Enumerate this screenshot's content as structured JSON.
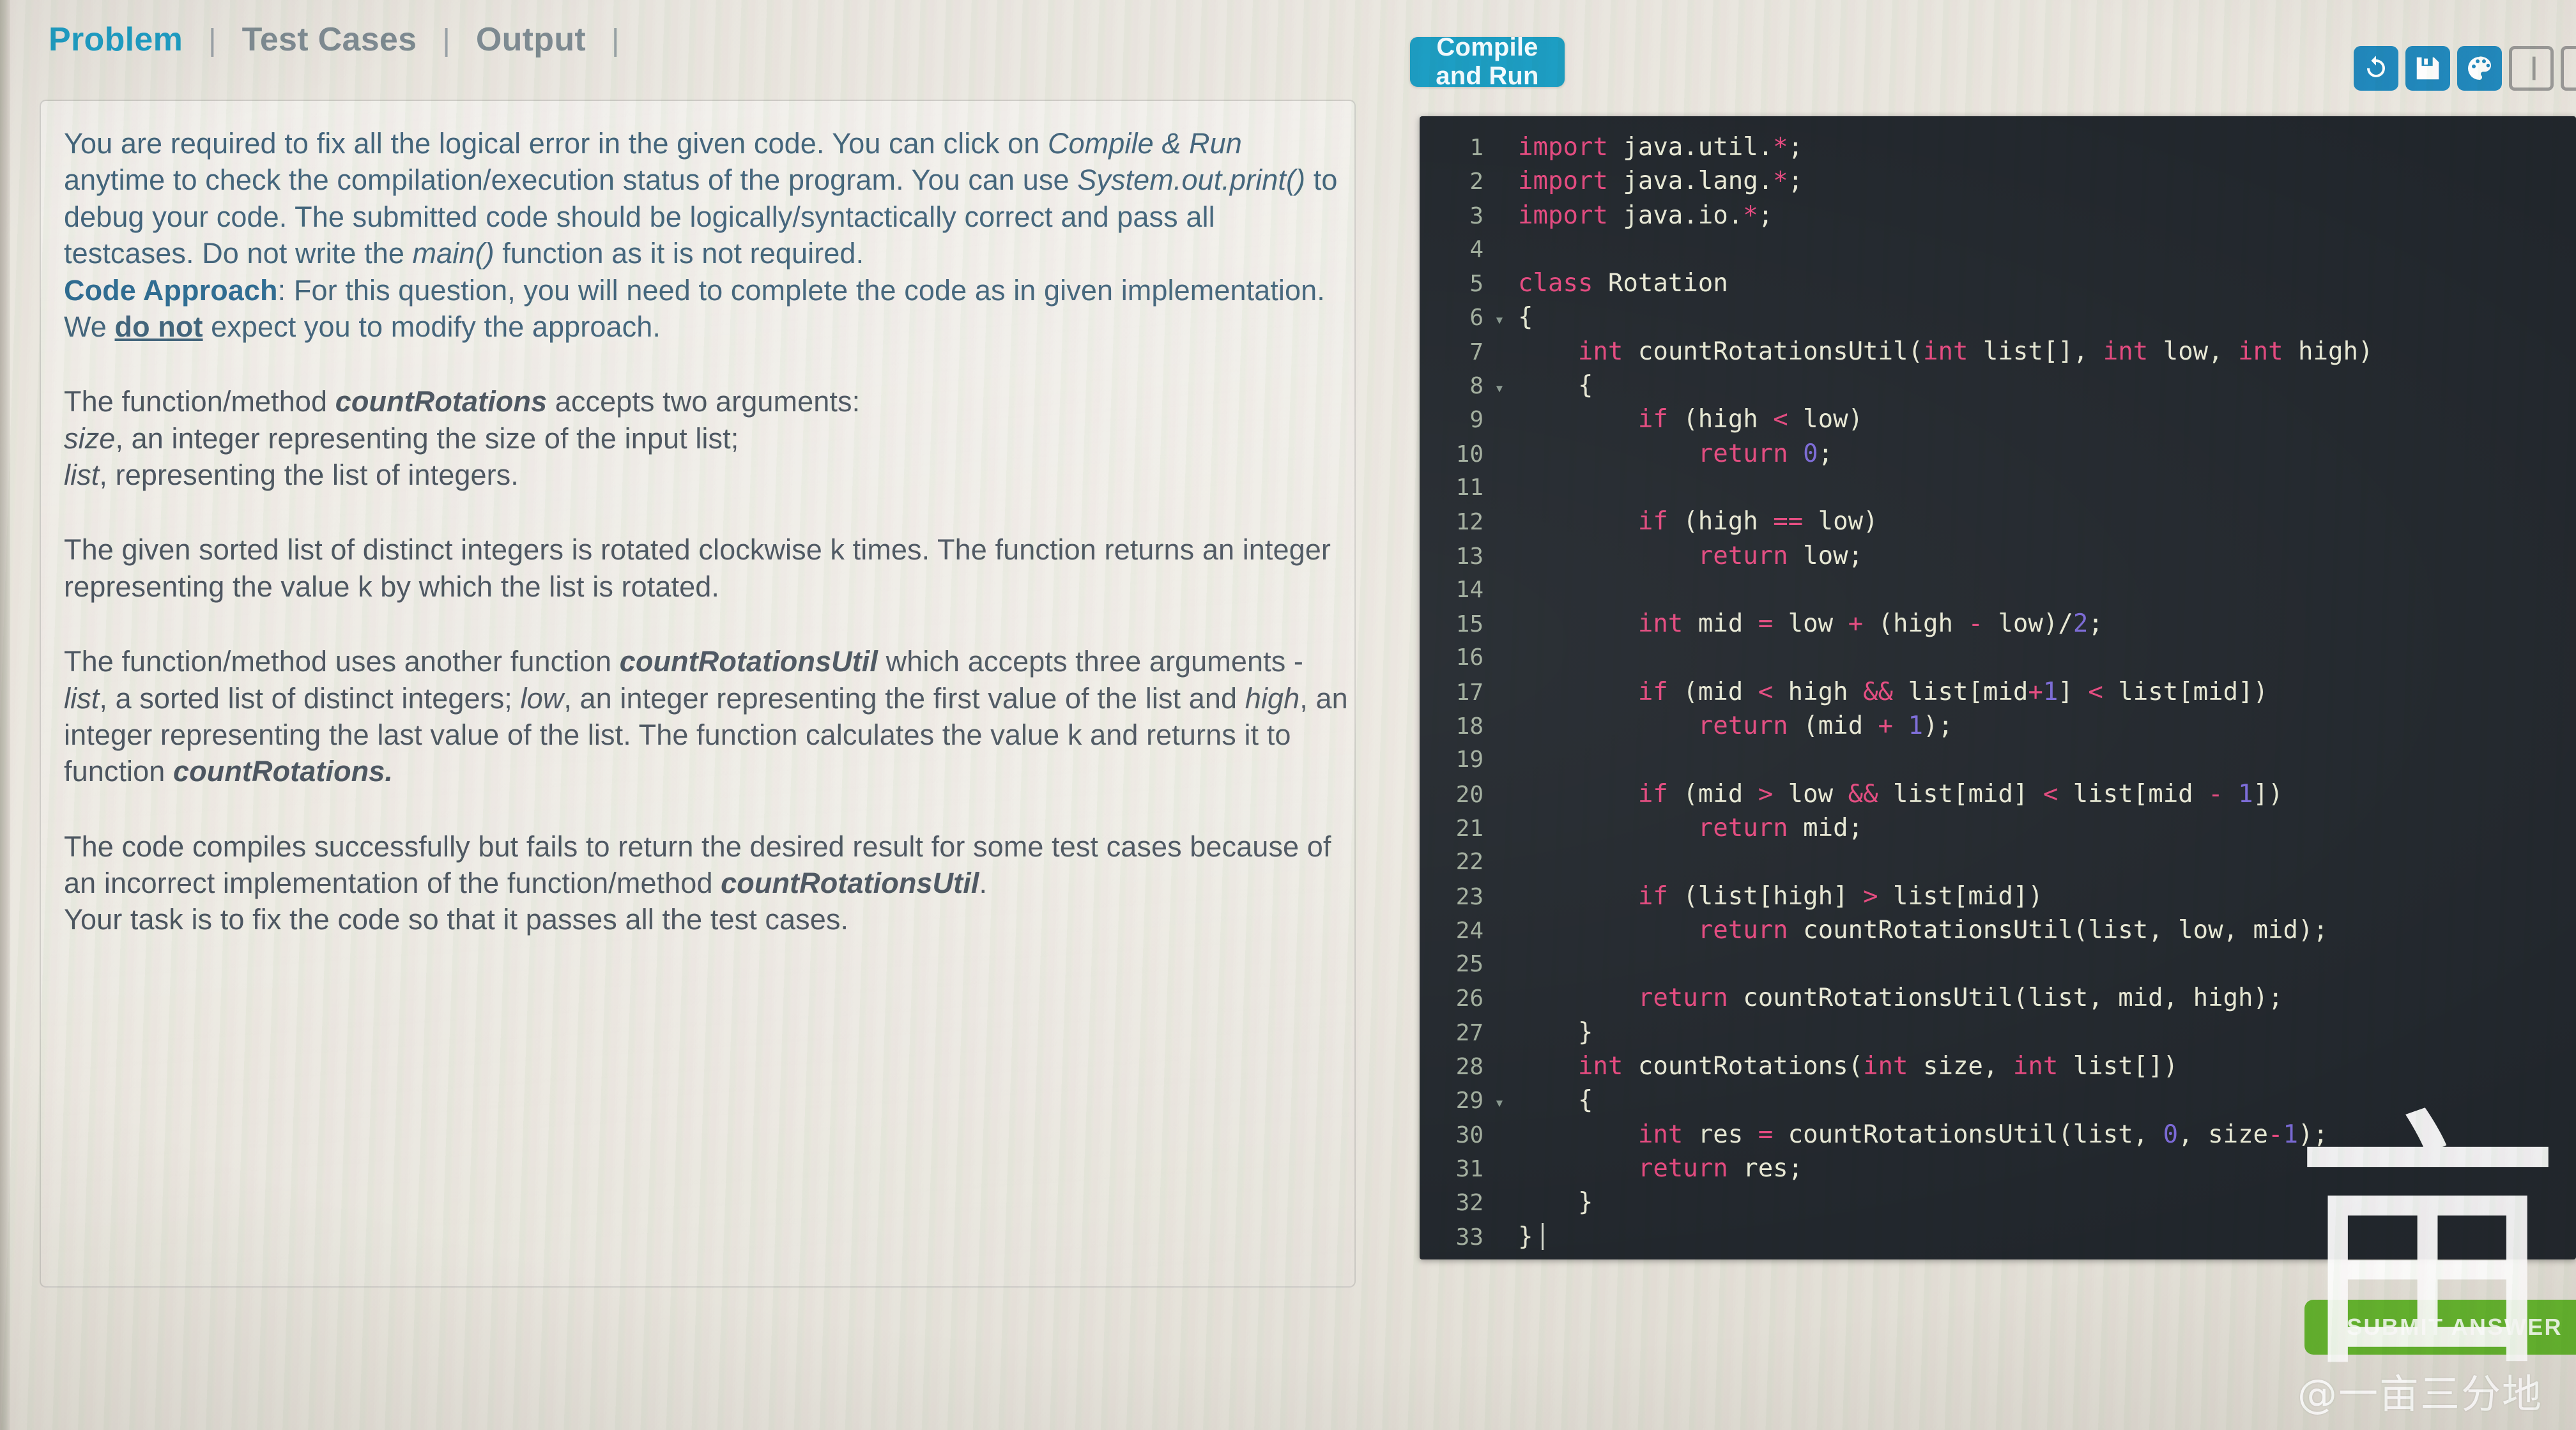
{
  "tabs": [
    {
      "label": "Problem",
      "active": true
    },
    {
      "label": "Test Cases",
      "active": false
    },
    {
      "label": "Output",
      "active": false
    }
  ],
  "tab_separator": "|",
  "toolbar": {
    "compile_run_label": "Compile and Run",
    "icons": [
      {
        "name": "reset-icon",
        "style": "filled"
      },
      {
        "name": "save-icon",
        "style": "filled"
      },
      {
        "name": "theme-palette-icon",
        "style": "filled"
      },
      {
        "name": "split-layout-icon",
        "style": "outline"
      },
      {
        "name": "layout-icon-partial",
        "style": "outline"
      }
    ]
  },
  "problem": {
    "intro": {
      "part1": "You are required to fix all the logical error in the given code. You can click on ",
      "em1": "Compile & Run",
      "part2": " anytime to check the compilation/execution status of the program. You can use ",
      "em2": "System.out.print()",
      "part3": " to debug your code. The submitted code should be logically/syntactically correct and pass all testcases. Do not write the ",
      "em3": "main()",
      "part4": " function as it is not required."
    },
    "code_approach": {
      "heading": "Code Approach",
      "part1": ": For this question, you will need to complete the code as in given implementation. We ",
      "emphasis": "do not",
      "part2": " expect you to modify the approach."
    },
    "para_signature": {
      "line1_pre": "The function/method ",
      "line1_fn": "countRotations",
      "line1_post": " accepts two arguments:",
      "line2_em": "size",
      "line2_post": ", an integer representing the size of the input list;",
      "line3_em": "list",
      "line3_post": ", representing the list of integers."
    },
    "para_rotation": "The given sorted list of distinct integers is rotated clockwise k times. The function returns an integer representing the value k by which the list is rotated.",
    "para_util": {
      "pre": "The function/method uses another function ",
      "fn1": "countRotationsUtil",
      "mid1": " which accepts three arguments - ",
      "em1": "list",
      "mid2": ", a sorted list of distinct integers; ",
      "em2": "low",
      "mid3": ", an integer representing the first value of the list and ",
      "em3": "high",
      "mid4": ", an integer representing the last value of the list. The function calculates the value k and returns it to function ",
      "fn2": "countRotations."
    },
    "para_task": {
      "pre": "The code compiles successfully but fails to return the desired result for some test cases because of an incorrect implementation of the function/method ",
      "fn": "countRotationsUtil",
      "post": ".",
      "last_line": "Your task is to fix the code so that it passes all the test cases."
    }
  },
  "editor": {
    "language": "java",
    "total_lines": 33,
    "lines": [
      {
        "n": 1,
        "fold": "",
        "tokens": [
          [
            "kw",
            "import"
          ],
          [
            "id",
            " java.util."
          ],
          [
            "op",
            "*"
          ],
          [
            "punc",
            ";"
          ]
        ]
      },
      {
        "n": 2,
        "fold": "",
        "tokens": [
          [
            "kw",
            "import"
          ],
          [
            "id",
            " java.lang."
          ],
          [
            "op",
            "*"
          ],
          [
            "punc",
            ";"
          ]
        ]
      },
      {
        "n": 3,
        "fold": "",
        "tokens": [
          [
            "kw",
            "import"
          ],
          [
            "id",
            " java.io."
          ],
          [
            "op",
            "*"
          ],
          [
            "punc",
            ";"
          ]
        ]
      },
      {
        "n": 4,
        "fold": "",
        "tokens": []
      },
      {
        "n": 5,
        "fold": "",
        "tokens": [
          [
            "kw",
            "class"
          ],
          [
            "id",
            " Rotation"
          ]
        ]
      },
      {
        "n": 6,
        "fold": "▾",
        "tokens": [
          [
            "punc",
            "{"
          ]
        ]
      },
      {
        "n": 7,
        "fold": "",
        "tokens": [
          [
            "id",
            "    "
          ],
          [
            "kw",
            "int"
          ],
          [
            "id",
            " countRotationsUtil("
          ],
          [
            "kw",
            "int"
          ],
          [
            "id",
            " list[]"
          ],
          [
            "punc",
            ", "
          ],
          [
            "kw",
            "int"
          ],
          [
            "id",
            " low"
          ],
          [
            "punc",
            ", "
          ],
          [
            "kw",
            "int"
          ],
          [
            "id",
            " high)"
          ]
        ]
      },
      {
        "n": 8,
        "fold": "▾",
        "tokens": [
          [
            "id",
            "    "
          ],
          [
            "punc",
            "{"
          ]
        ]
      },
      {
        "n": 9,
        "fold": "",
        "tokens": [
          [
            "id",
            "        "
          ],
          [
            "kw",
            "if"
          ],
          [
            "punc",
            " (high "
          ],
          [
            "op",
            "<"
          ],
          [
            "punc",
            " low)"
          ]
        ]
      },
      {
        "n": 10,
        "fold": "",
        "tokens": [
          [
            "id",
            "            "
          ],
          [
            "kw",
            "return"
          ],
          [
            "punc",
            " "
          ],
          [
            "num",
            "0"
          ],
          [
            "punc",
            ";"
          ]
        ]
      },
      {
        "n": 11,
        "fold": "",
        "tokens": []
      },
      {
        "n": 12,
        "fold": "",
        "tokens": [
          [
            "id",
            "        "
          ],
          [
            "kw",
            "if"
          ],
          [
            "punc",
            " (high "
          ],
          [
            "op",
            "=="
          ],
          [
            "punc",
            " low)"
          ]
        ]
      },
      {
        "n": 13,
        "fold": "",
        "tokens": [
          [
            "id",
            "            "
          ],
          [
            "kw",
            "return"
          ],
          [
            "punc",
            " low;"
          ]
        ]
      },
      {
        "n": 14,
        "fold": "",
        "tokens": []
      },
      {
        "n": 15,
        "fold": "",
        "tokens": [
          [
            "id",
            "        "
          ],
          [
            "kw",
            "int"
          ],
          [
            "punc",
            " mid "
          ],
          [
            "op",
            "="
          ],
          [
            "punc",
            " low "
          ],
          [
            "op",
            "+"
          ],
          [
            "punc",
            " (high "
          ],
          [
            "op",
            "-"
          ],
          [
            "punc",
            " low)/"
          ],
          [
            "num",
            "2"
          ],
          [
            "punc",
            ";"
          ]
        ]
      },
      {
        "n": 16,
        "fold": "",
        "tokens": []
      },
      {
        "n": 17,
        "fold": "",
        "tokens": [
          [
            "id",
            "        "
          ],
          [
            "kw",
            "if"
          ],
          [
            "punc",
            " (mid "
          ],
          [
            "op",
            "<"
          ],
          [
            "punc",
            " high "
          ],
          [
            "op",
            "&&"
          ],
          [
            "punc",
            " list[mid"
          ],
          [
            "op",
            "+"
          ],
          [
            "num",
            "1"
          ],
          [
            "punc",
            "] "
          ],
          [
            "op",
            "<"
          ],
          [
            "punc",
            " list[mid])"
          ]
        ]
      },
      {
        "n": 18,
        "fold": "",
        "tokens": [
          [
            "id",
            "            "
          ],
          [
            "kw",
            "return"
          ],
          [
            "punc",
            " (mid "
          ],
          [
            "op",
            "+"
          ],
          [
            "punc",
            " "
          ],
          [
            "num",
            "1"
          ],
          [
            "punc",
            ");"
          ]
        ]
      },
      {
        "n": 19,
        "fold": "",
        "tokens": []
      },
      {
        "n": 20,
        "fold": "",
        "tokens": [
          [
            "id",
            "        "
          ],
          [
            "kw",
            "if"
          ],
          [
            "punc",
            " (mid "
          ],
          [
            "op",
            ">"
          ],
          [
            "punc",
            " low "
          ],
          [
            "op",
            "&&"
          ],
          [
            "punc",
            " list[mid] "
          ],
          [
            "op",
            "<"
          ],
          [
            "punc",
            " list[mid "
          ],
          [
            "op",
            "-"
          ],
          [
            "punc",
            " "
          ],
          [
            "num",
            "1"
          ],
          [
            "punc",
            "])"
          ]
        ]
      },
      {
        "n": 21,
        "fold": "",
        "tokens": [
          [
            "id",
            "            "
          ],
          [
            "kw",
            "return"
          ],
          [
            "punc",
            " mid;"
          ]
        ]
      },
      {
        "n": 22,
        "fold": "",
        "tokens": []
      },
      {
        "n": 23,
        "fold": "",
        "tokens": [
          [
            "id",
            "        "
          ],
          [
            "kw",
            "if"
          ],
          [
            "punc",
            " (list[high] "
          ],
          [
            "op",
            ">"
          ],
          [
            "punc",
            " list[mid])"
          ]
        ]
      },
      {
        "n": 24,
        "fold": "",
        "tokens": [
          [
            "id",
            "            "
          ],
          [
            "kw",
            "return"
          ],
          [
            "punc",
            " countRotationsUtil(list, low, mid);"
          ]
        ]
      },
      {
        "n": 25,
        "fold": "",
        "tokens": []
      },
      {
        "n": 26,
        "fold": "",
        "tokens": [
          [
            "id",
            "        "
          ],
          [
            "kw",
            "return"
          ],
          [
            "punc",
            " countRotationsUtil(list, mid, high);"
          ]
        ]
      },
      {
        "n": 27,
        "fold": "",
        "tokens": [
          [
            "id",
            "    "
          ],
          [
            "punc",
            "}"
          ]
        ]
      },
      {
        "n": 28,
        "fold": "",
        "tokens": [
          [
            "id",
            "    "
          ],
          [
            "kw",
            "int"
          ],
          [
            "id",
            " countRotations("
          ],
          [
            "kw",
            "int"
          ],
          [
            "id",
            " size"
          ],
          [
            "punc",
            ", "
          ],
          [
            "kw",
            "int"
          ],
          [
            "id",
            " list[])"
          ]
        ]
      },
      {
        "n": 29,
        "fold": "▾",
        "tokens": [
          [
            "id",
            "    "
          ],
          [
            "punc",
            "{"
          ]
        ]
      },
      {
        "n": 30,
        "fold": "",
        "tokens": [
          [
            "id",
            "        "
          ],
          [
            "kw",
            "int"
          ],
          [
            "punc",
            " res "
          ],
          [
            "op",
            "="
          ],
          [
            "punc",
            " countRotationsUtil(list, "
          ],
          [
            "num",
            "0"
          ],
          [
            "punc",
            ", size"
          ],
          [
            "op",
            "-"
          ],
          [
            "num",
            "1"
          ],
          [
            "punc",
            ");"
          ]
        ]
      },
      {
        "n": 31,
        "fold": "",
        "tokens": [
          [
            "id",
            "        "
          ],
          [
            "kw",
            "return"
          ],
          [
            "punc",
            " res;"
          ]
        ]
      },
      {
        "n": 32,
        "fold": "",
        "tokens": [
          [
            "id",
            "    "
          ],
          [
            "punc",
            "}"
          ]
        ]
      },
      {
        "n": 33,
        "fold": "",
        "tokens": [
          [
            "punc",
            "}"
          ]
        ],
        "caret": true
      }
    ]
  },
  "submit": {
    "label": "SUBMIT ANSWER"
  },
  "watermark": {
    "glyph": "亩",
    "handle": "@一亩三分地"
  },
  "colors": {
    "accent_teal": "#1b9dc3",
    "submit_green": "#63b22d",
    "editor_bg": "#21262c",
    "keyword_pink": "#e5497f",
    "number_purple": "#7b6ad8",
    "identifier_cream": "#e9ead6",
    "linenumber_sage": "#b9c6b2",
    "tab_active": "#1d9dc4",
    "tab_idle": "#7e8b92",
    "problem_text": "#4d5b66"
  }
}
